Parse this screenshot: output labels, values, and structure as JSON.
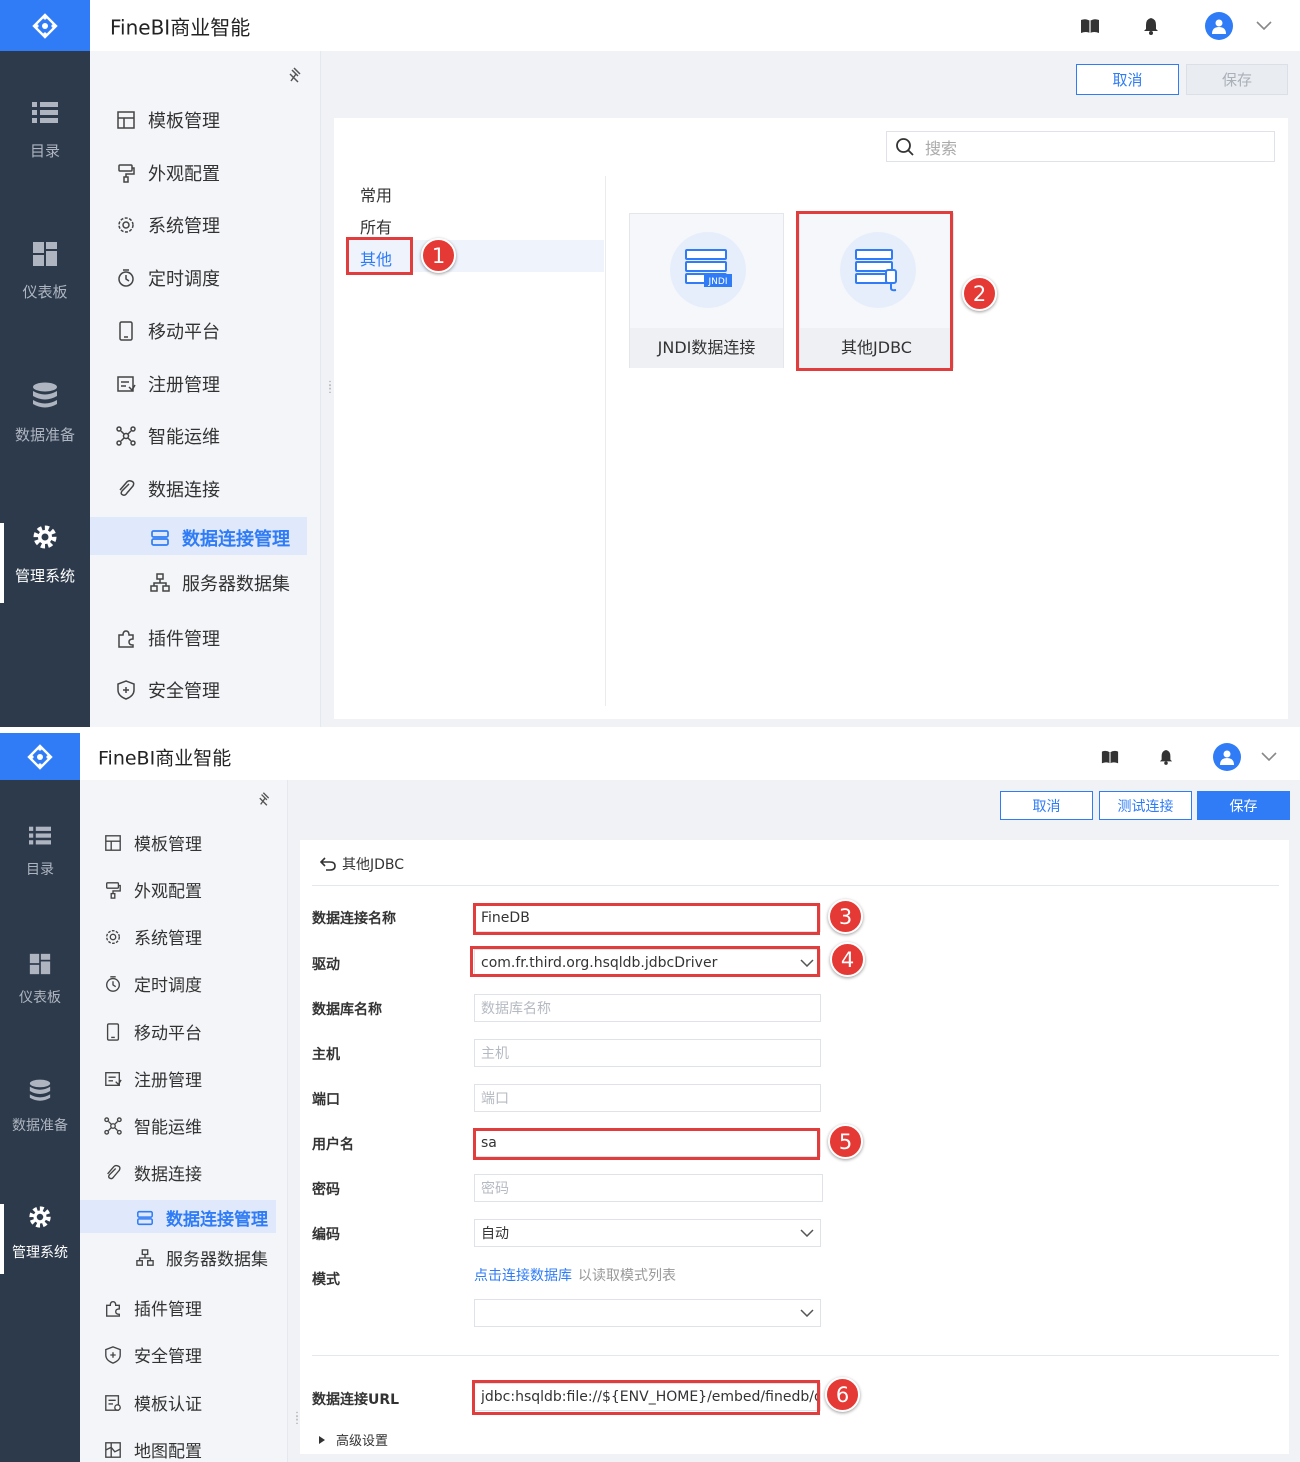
{
  "app": {
    "title": "FineBI商业智能"
  },
  "nav": {
    "items": [
      {
        "label": "目录",
        "icon": "list-icon"
      },
      {
        "label": "仪表板",
        "icon": "dashboard-icon"
      },
      {
        "label": "数据准备",
        "icon": "database-icon"
      },
      {
        "label": "管理系统",
        "icon": "gear-icon",
        "active": true
      }
    ]
  },
  "menu": {
    "items": [
      "模板管理",
      "外观配置",
      "系统管理",
      "定时调度",
      "移动平台",
      "注册管理",
      "智能运维",
      "数据连接"
    ],
    "sub_items": [
      "数据连接管理",
      "服务器数据集"
    ],
    "items_after": [
      "插件管理",
      "安全管理"
    ],
    "items_after_s2_extra": [
      "模板认证",
      "地图配置"
    ]
  },
  "screen1": {
    "buttons": {
      "cancel": "取消",
      "save": "保存"
    },
    "search_placeholder": "搜索",
    "categories": [
      "常用",
      "所有",
      "其他"
    ],
    "cards": [
      {
        "label": "JNDI数据连接",
        "tag": "JNDI"
      },
      {
        "label": "其他JDBC"
      }
    ]
  },
  "screen2": {
    "buttons": {
      "cancel": "取消",
      "test": "测试连接",
      "save": "保存"
    },
    "back_label": "其他JDBC",
    "form": {
      "conn_name_label": "数据连接名称",
      "conn_name_value": "FineDB",
      "driver_label": "驱动",
      "driver_value": "com.fr.third.org.hsqldb.jdbcDriver",
      "db_name_label": "数据库名称",
      "db_name_placeholder": "数据库名称",
      "host_label": "主机",
      "host_placeholder": "主机",
      "port_label": "端口",
      "port_placeholder": "端口",
      "user_label": "用户名",
      "user_value": "sa",
      "password_label": "密码",
      "password_placeholder": "密码",
      "encoding_label": "编码",
      "encoding_value": "自动",
      "mode_label": "模式",
      "mode_link": "点击连接数据库",
      "mode_hint": "以读取模式列表",
      "url_label": "数据连接URL",
      "url_value": "jdbc:hsqldb:file://${ENV_HOME}/embed/finedb/db",
      "advanced": "高级设置"
    }
  },
  "annotations": [
    "1",
    "2",
    "3",
    "4",
    "5",
    "6"
  ],
  "colors": {
    "accent": "#2f7cf6",
    "nav_bg": "#2d3a4b",
    "annotation_red": "#e23d3d"
  }
}
